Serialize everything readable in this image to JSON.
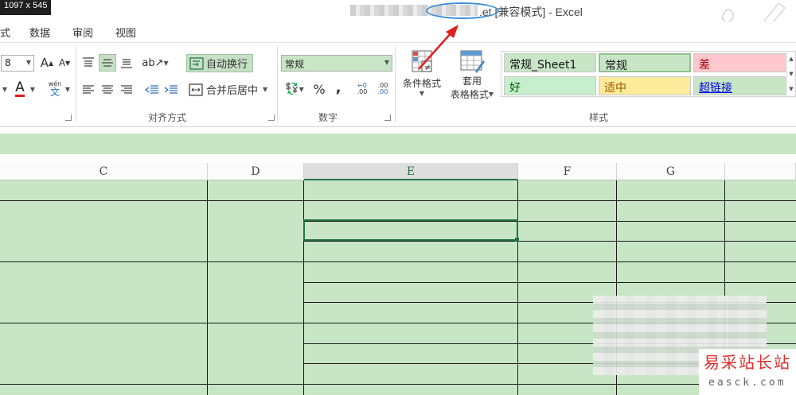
{
  "screenshot_badge": "1097 x 545",
  "window": {
    "title": ".et  [兼容模式] - Excel"
  },
  "menu": [
    "式",
    "数据",
    "审阅",
    "视图"
  ],
  "ribbon": {
    "font": {
      "size": "8",
      "grow_label": "A",
      "shrink_label": "A",
      "font_color_label": "A",
      "phonetic_label": "wén"
    },
    "alignment": {
      "wrap_text": "自动换行",
      "merge_center": "合并后居中",
      "group_label": "对齐方式"
    },
    "number": {
      "format": "常规",
      "percent": "%",
      "comma": ",",
      "inc_decimal": ".00",
      "dec_decimal": ".00",
      "group_label": "数字"
    },
    "styles": {
      "conditional_format": "条件格式",
      "table_format_line1": "套用",
      "table_format_line2": "表格格式",
      "cells": [
        {
          "label": "常规_Sheet1",
          "bg": "#c8e6c6",
          "color": "#111111"
        },
        {
          "label": "常规",
          "bg": "#c8e6c6",
          "color": "#111111"
        },
        {
          "label": "差",
          "bg": "#ffc7ce",
          "color": "#9c0006"
        },
        {
          "label": "好",
          "bg": "#c6efce",
          "color": "#006100"
        },
        {
          "label": "适中",
          "bg": "#ffeb9c",
          "color": "#9c5700"
        },
        {
          "label": "超链接",
          "bg": "#c8e6c6",
          "color": "#0000ee"
        }
      ],
      "group_label": "样式"
    }
  },
  "sheet": {
    "columns": [
      "C",
      "D",
      "E",
      "F",
      "G",
      ""
    ],
    "selected_column": "E",
    "fill_color": "#c8e6c6",
    "selection_color": "#217346"
  },
  "watermark": {
    "title": "易采站长站",
    "url": "easck.com"
  },
  "annotation": {
    "arrow_color": "#e02020",
    "oval_color": "#3c8fd6"
  }
}
